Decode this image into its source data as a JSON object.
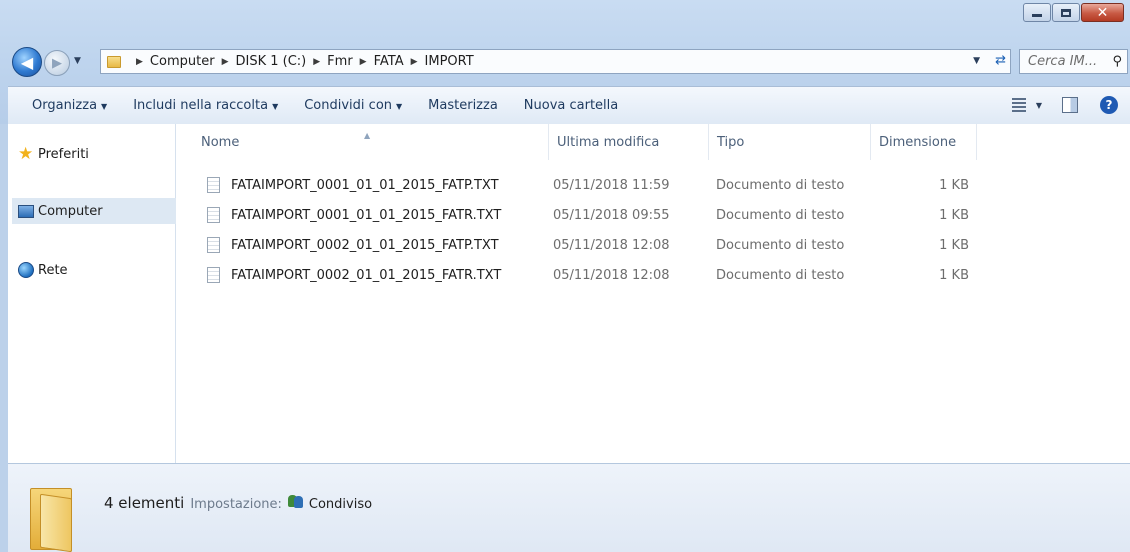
{
  "window": {
    "buttons": {
      "minimize": "minimize",
      "maximize": "maximize",
      "close": "close"
    },
    "close_color": "#c85a44"
  },
  "address": {
    "crumbs": [
      "Computer",
      "DISK 1 (C:)",
      "Fmr",
      "FATA",
      "IMPORT"
    ],
    "search_placeholder": "Cerca IM..."
  },
  "toolbar": {
    "organize": "Organizza",
    "include": "Includi nella raccolta",
    "share": "Condividi con",
    "burn": "Masterizza",
    "new_folder": "Nuova cartella"
  },
  "nav": {
    "favorites": "Preferiti",
    "computer": "Computer",
    "network": "Rete"
  },
  "columns": {
    "name": "Nome",
    "modified": "Ultima modifica",
    "type": "Tipo",
    "size": "Dimensione"
  },
  "files": [
    {
      "name": "FATAIMPORT_0001_01_01_2015_FATP.TXT",
      "modified": "05/11/2018 11:59",
      "type": "Documento di testo",
      "size": "1 KB"
    },
    {
      "name": "FATAIMPORT_0001_01_01_2015_FATR.TXT",
      "modified": "05/11/2018 09:55",
      "type": "Documento di testo",
      "size": "1 KB"
    },
    {
      "name": "FATAIMPORT_0002_01_01_2015_FATP.TXT",
      "modified": "05/11/2018 12:08",
      "type": "Documento di testo",
      "size": "1 KB"
    },
    {
      "name": "FATAIMPORT_0002_01_01_2015_FATR.TXT",
      "modified": "05/11/2018 12:08",
      "type": "Documento di testo",
      "size": "1 KB"
    }
  ],
  "details": {
    "count": "4 elementi",
    "setting_label": "Impostazione:",
    "shared": "Condiviso"
  },
  "icons": {
    "back": "back-arrow-icon",
    "forward": "forward-arrow-icon",
    "folder": "folder-icon",
    "refresh": "refresh-icon",
    "search": "search-icon",
    "views": "views-icon",
    "preview": "preview-pane-icon",
    "help": "help-icon",
    "favorites": "star-icon",
    "computer": "computer-icon",
    "network": "network-globe-icon",
    "file": "text-file-icon",
    "share": "shared-users-icon"
  }
}
